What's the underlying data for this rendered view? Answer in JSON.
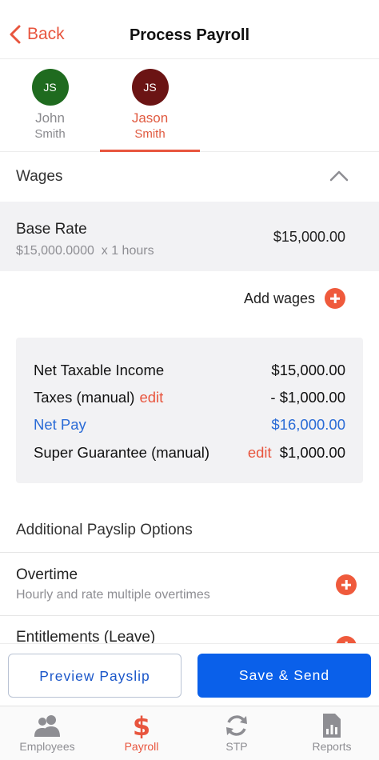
{
  "header": {
    "back_label": "Back",
    "title": "Process Payroll"
  },
  "employees": [
    {
      "initials": "JS",
      "first": "John",
      "last": "Smith",
      "avatar_color": "#1f6b1f",
      "active": false
    },
    {
      "initials": "JS",
      "first": "Jason",
      "last": "Smith",
      "avatar_color": "#6b1414",
      "active": true
    }
  ],
  "wages": {
    "section_label": "Wages",
    "base_rate": {
      "name": "Base Rate",
      "rate": "$15,000.0000",
      "hours": "x 1 hours",
      "amount": "$15,000.00"
    },
    "add_label": "Add wages"
  },
  "summary": {
    "net_taxable_label": "Net Taxable Income",
    "net_taxable_value": "$15,000.00",
    "taxes_label": "Taxes (manual)",
    "taxes_edit": "edit",
    "taxes_value": "- $1,000.00",
    "net_pay_label": "Net Pay",
    "net_pay_value": "$16,000.00",
    "super_label": "Super Guarantee (manual)",
    "super_edit": "edit",
    "super_value": "$1,000.00"
  },
  "options": {
    "title": "Additional Payslip Options",
    "items": [
      {
        "title": "Overtime",
        "subtitle": "Hourly and rate multiple overtimes"
      },
      {
        "title": "Entitlements (Leave)",
        "subtitle": ""
      }
    ]
  },
  "buttons": {
    "preview": "Preview Payslip",
    "save": "Save & Send"
  },
  "tabbar": [
    {
      "label": "Employees",
      "icon": "people-icon",
      "active": false
    },
    {
      "label": "Payroll",
      "icon": "dollar-icon",
      "active": true
    },
    {
      "label": "STP",
      "icon": "sync-icon",
      "active": false
    },
    {
      "label": "Reports",
      "icon": "report-icon",
      "active": false
    }
  ],
  "colors": {
    "accent": "#e8553e",
    "primary": "#0a60ea",
    "net_pay": "#2a6bd6"
  }
}
